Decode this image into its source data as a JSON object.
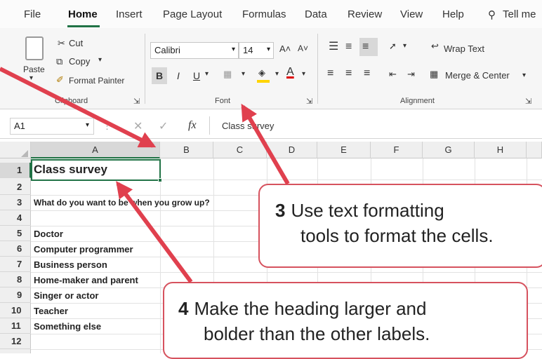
{
  "tabs": [
    "File",
    "Home",
    "Insert",
    "Page Layout",
    "Formulas",
    "Data",
    "Review",
    "View",
    "Help",
    "Tell me"
  ],
  "ribbon": {
    "clipboard": {
      "paste": "Paste",
      "cut": "Cut",
      "copy": "Copy",
      "format_painter": "Format Painter",
      "label": "Clipboard"
    },
    "font": {
      "name": "Calibri",
      "size": "14",
      "grow": "A˄",
      "shrink": "A˅",
      "bold": "B",
      "italic": "I",
      "underline": "U",
      "label": "Font"
    },
    "alignment": {
      "wrap_text": "Wrap Text",
      "merge_center": "Merge & Center",
      "label": "Alignment"
    }
  },
  "formula_bar": {
    "name_box": "A1",
    "fx": "fx",
    "value": "Class survey"
  },
  "columns": [
    "A",
    "B",
    "C",
    "D",
    "E",
    "F",
    "G",
    "H"
  ],
  "rows": [
    "1",
    "2",
    "3",
    "4",
    "5",
    "6",
    "7",
    "8",
    "9",
    "10",
    "11",
    "12"
  ],
  "cells": {
    "A1": "Class survey",
    "A3": "What do you want to be when you grow up?",
    "A5": "Doctor",
    "A6": "Computer programmer",
    "A7": "Business person",
    "A8": "Home-maker and parent",
    "A9": "Singer or actor",
    "A10": "Teacher",
    "A11": "Something else"
  },
  "callouts": {
    "c3": {
      "num": "3",
      "line1": "Use text formatting",
      "line2": "tools to format the cells."
    },
    "c4": {
      "num": "4",
      "line1": "Make the heading larger and",
      "line2": "bolder than the other labels."
    }
  },
  "colors": {
    "arrow": "#e0404e",
    "accent": "#217346"
  }
}
